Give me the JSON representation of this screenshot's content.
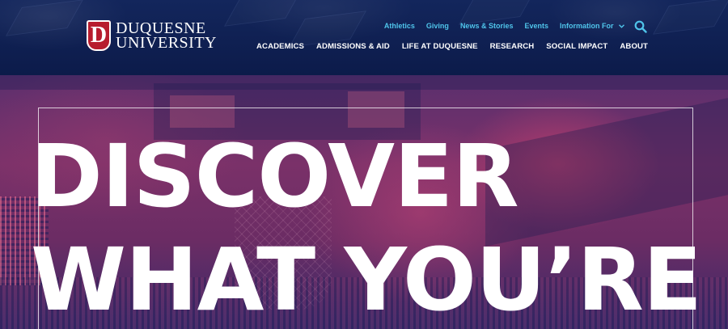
{
  "header": {
    "logo": {
      "mark": "D",
      "line1": "DUQUESNE",
      "line2": "UNIVERSITY"
    },
    "utility_nav": [
      "Athletics",
      "Giving",
      "News & Stories",
      "Events",
      "Information For"
    ],
    "main_nav": [
      "ACADEMICS",
      "ADMISSIONS & AID",
      "LIFE AT DUQUESNE",
      "RESEARCH",
      "SOCIAL IMPACT",
      "ABOUT"
    ],
    "icons": {
      "dropdown": "chevron-down-icon",
      "search": "search-icon"
    }
  },
  "hero": {
    "headline_line1": "DISCOVER",
    "headline_line2": "WHAT YOU’RE"
  },
  "colors": {
    "header_bg": "#0c1b4a",
    "utility_link": "#4fc4ea",
    "brand_red": "#b71c2e",
    "hero_tint": "#7a3169"
  }
}
